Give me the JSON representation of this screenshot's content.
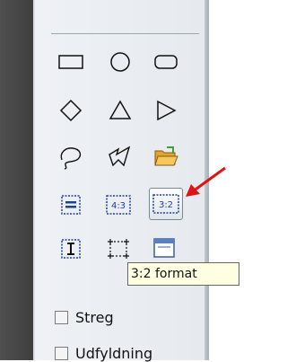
{
  "tooltip": {
    "text": "3:2 format"
  },
  "tools": {
    "row1": [
      "rectangle-icon",
      "ellipse-icon",
      "rounded-rectangle-icon"
    ],
    "row2": [
      "diamond-icon",
      "triangle-icon",
      "right-triangle-icon"
    ],
    "row3": [
      "freeform-lasso-icon",
      "freeform-polygon-icon",
      "open-folder-icon"
    ],
    "row4": [
      "full-width-format-icon",
      "4:3-format-icon",
      "3:2-format-icon"
    ],
    "row5": [
      "text-cursor-icon",
      "dotted-selection-icon",
      "window-icon"
    ],
    "format_43_label": "4:3",
    "format_32_label": "3:2"
  },
  "options": {
    "stroke_label": "Streg",
    "fill_label": "Udfyldning"
  },
  "colors": {
    "accent_arrow": "#e01414",
    "tooltip_bg": "#ffffe1",
    "icon_blue": "#1f3f9f"
  }
}
